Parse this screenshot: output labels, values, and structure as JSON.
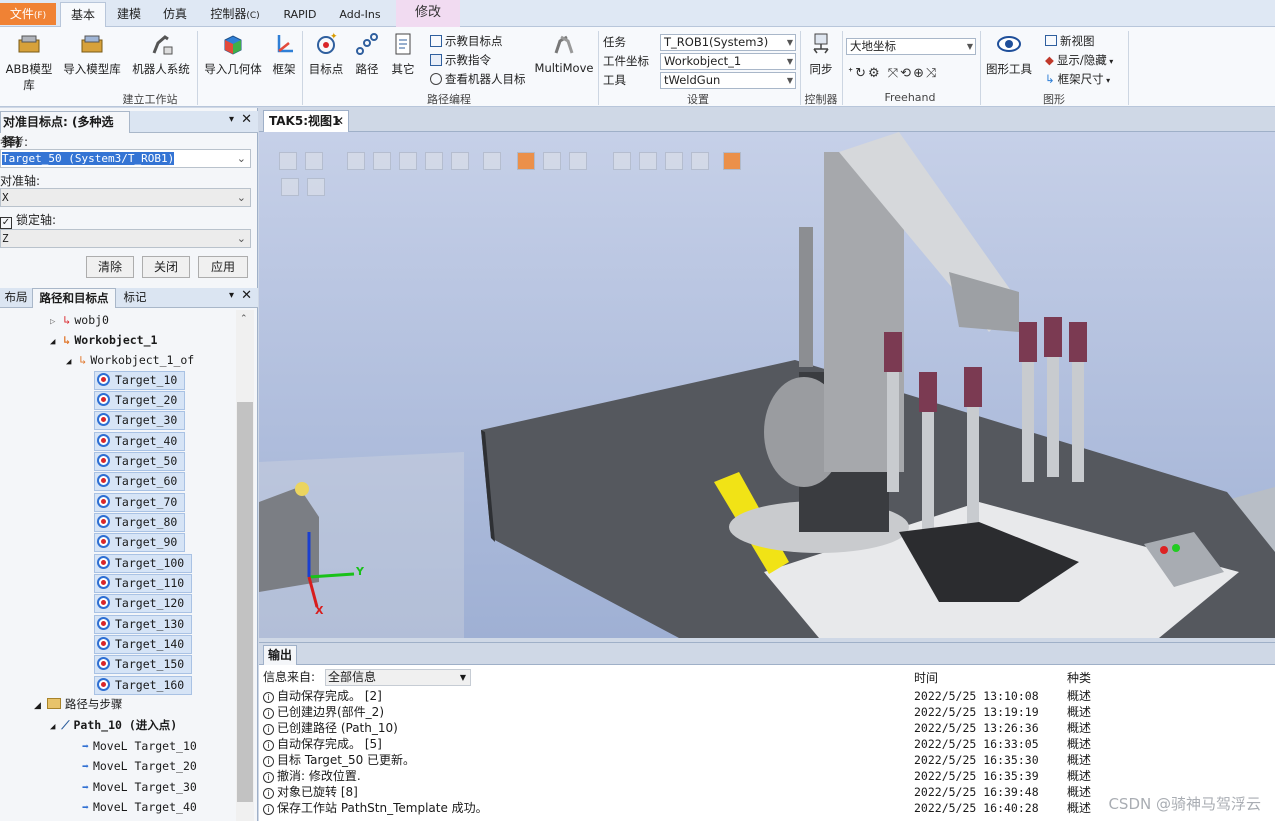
{
  "ribbon_tabs": [
    {
      "label": "文件",
      "hint": "(F)"
    },
    {
      "label": "基本"
    },
    {
      "label": "建模"
    },
    {
      "label": "仿真"
    },
    {
      "label": "控制器",
      "hint": "(C)"
    },
    {
      "label": "RAPID"
    },
    {
      "label": "Add-Ins"
    },
    {
      "label": "修改"
    }
  ],
  "ribbon": {
    "build_station": {
      "label": "建立工作站",
      "buttons": [
        "ABB模型库",
        "导入模型库",
        "机器人系统",
        "导入几何体",
        "框架"
      ]
    },
    "path_programming": {
      "label": "路径编程",
      "buttons": [
        "目标点",
        "路径",
        "其它"
      ],
      "small": [
        "示教目标点",
        "示教指令",
        "查看机器人目标"
      ],
      "multimove": "MultiMove"
    },
    "settings": {
      "label": "设置",
      "rows": [
        {
          "label": "任务",
          "value": "T_ROB1(System3)"
        },
        {
          "label": "工件坐标",
          "value": "Workobject_1"
        },
        {
          "label": "工具",
          "value": "tWeldGun"
        }
      ]
    },
    "controller": {
      "label": "控制器",
      "button": "同步"
    },
    "freehand": {
      "label": "Freehand",
      "coord": "大地坐标"
    },
    "graphics": {
      "label": "图形",
      "button": "图形工具",
      "small": [
        "新视图",
        "显示/隐藏",
        "框架尺寸"
      ]
    }
  },
  "align_panel": {
    "title": "对准目标点: (多种选择)",
    "ref_label": "参考:",
    "ref_value": "Target_50 (System3/T_ROB1)",
    "axis_label": "对准轴:",
    "axis_value": "X",
    "lock_label": "锁定轴:",
    "lock_value": "Z",
    "buttons": {
      "clear": "清除",
      "close": "关闭",
      "apply": "应用"
    }
  },
  "tree_panel": {
    "tabs": [
      "布局",
      "路径和目标点",
      "标记"
    ],
    "wobj0": "wobj0",
    "workobject": "Workobject_1",
    "workobject_of": "Workobject_1_of",
    "targets": [
      "Target_10",
      "Target_20",
      "Target_30",
      "Target_40",
      "Target_50",
      "Target_60",
      "Target_70",
      "Target_80",
      "Target_90",
      "Target_100",
      "Target_110",
      "Target_120",
      "Target_130",
      "Target_140",
      "Target_150",
      "Target_160"
    ],
    "paths_folder": "路径与步骤",
    "path": "Path_10 (进入点)",
    "moves": [
      "MoveL Target_10",
      "MoveL Target_20",
      "MoveL Target_30",
      "MoveL Target_40"
    ]
  },
  "viewport": {
    "tab": "TAK5:视图1",
    "axis_x": "X",
    "axis_y": "Y"
  },
  "output": {
    "tab": "输出",
    "filter_label": "信息来自:",
    "filter_value": "全部信息",
    "col_time": "时间",
    "col_category": "种类",
    "rows": [
      {
        "msg": "自动保存完成。 [2]",
        "time": "2022/5/25 13:10:08",
        "cat": "概述"
      },
      {
        "msg": "已创建边界(部件_2)",
        "time": "2022/5/25 13:19:19",
        "cat": "概述"
      },
      {
        "msg": "已创建路径 (Path_10)",
        "time": "2022/5/25 13:26:36",
        "cat": "概述"
      },
      {
        "msg": "自动保存完成。 [5]",
        "time": "2022/5/25 16:33:05",
        "cat": "概述"
      },
      {
        "msg": "目标 Target_50 已更新。",
        "time": "2022/5/25 16:35:30",
        "cat": "概述"
      },
      {
        "msg": "撤消: 修改位置.",
        "time": "2022/5/25 16:35:39",
        "cat": "概述"
      },
      {
        "msg": "对象已旋转 [8]",
        "time": "2022/5/25 16:39:48",
        "cat": "概述"
      },
      {
        "msg": "保存工作站 PathStn_Template 成功。",
        "time": "2022/5/25 16:40:28",
        "cat": "概述"
      }
    ]
  },
  "watermark": "CSDN @骑神马驾浮云",
  "colors": {
    "file_tab": "#f08234",
    "modify_tab": "#f1dbf1",
    "selection": "#d6e4f6",
    "floor": "#55585e"
  }
}
